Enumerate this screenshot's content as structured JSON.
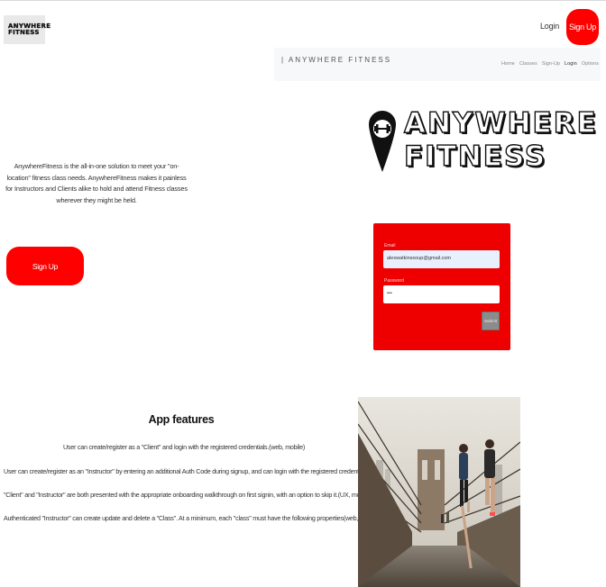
{
  "header": {
    "logo": {
      "line1": "ANYWHERE",
      "line2": "FITNESS"
    },
    "login_label": "Login",
    "signup_label": "Sign Up"
  },
  "hero": {
    "description": "AnywhereFitness is the all-in-one solution to meet your \"on-location\" fitness class needs. AnywhereFitness makes it painless for Instructors and Clients alike to hold and attend Fitness classes wherever they might be held.",
    "signup_label": "Sign Up"
  },
  "app_preview": {
    "brand": "| ANYWHERE FITNESS",
    "menu": [
      "Home",
      "Classes",
      "Sign-Up",
      "Login",
      "Options"
    ],
    "active_menu": "Login",
    "logo": {
      "line1": "ANYWHERE",
      "line2": "FITNESS"
    },
    "form": {
      "email_label": "Email",
      "email_value": "alexwatkinssoup@gmail.com",
      "password_label": "Password",
      "password_value": "•••",
      "submit_label": "Submit"
    }
  },
  "features": {
    "title": "App features",
    "items": [
      "User can create/register as a \"Client\" and login with the registered credentials.(web, mobile)",
      "User can create/register as an \"Instructor\" by entering an additional Auth Code during signup, and can login with the registered credentials.(web, mobile)",
      "\"Client\" and \"Instructor\" are both presented with the appropriate onboarding walkthrough on first signin, with an option to skip it.(UX, mobile)",
      "Authenticated \"Instructor\" can create update and delete a \"Class\". At a minimum, each \"class\" must have the following properties(web, mobile)"
    ]
  },
  "colors": {
    "accent": "#ff0000",
    "card": "#ee0000"
  }
}
